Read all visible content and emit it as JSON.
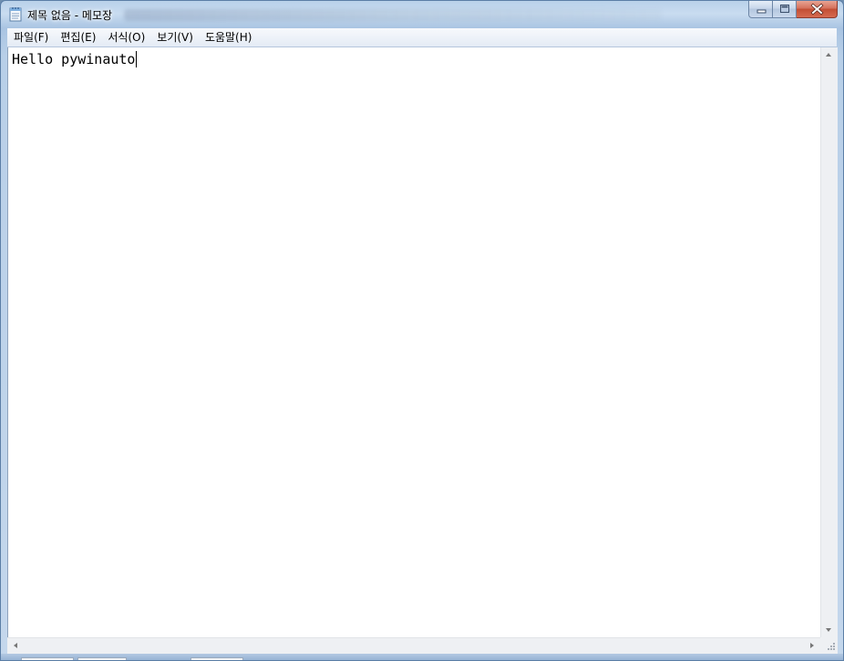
{
  "window": {
    "title": "제목 없음 - 메모장",
    "app_icon": "notepad-icon",
    "caption_buttons": {
      "minimize_icon": "minimize-icon",
      "maximize_icon": "maximize-icon",
      "close_icon": "close-icon"
    }
  },
  "menu": {
    "items": [
      {
        "label": "파일(F)"
      },
      {
        "label": "편집(E)"
      },
      {
        "label": "서식(O)"
      },
      {
        "label": "보기(V)"
      },
      {
        "label": "도움말(H)"
      }
    ]
  },
  "editor": {
    "content": "Hello pywinauto"
  },
  "scrollbars": {
    "up_icon": "arrow-up-icon",
    "down_icon": "arrow-down-icon",
    "left_icon": "arrow-left-icon",
    "right_icon": "arrow-right-icon"
  },
  "colors": {
    "frame": "#b9d1ea",
    "close_button": "#c24e35",
    "editor_bg": "#ffffff"
  }
}
